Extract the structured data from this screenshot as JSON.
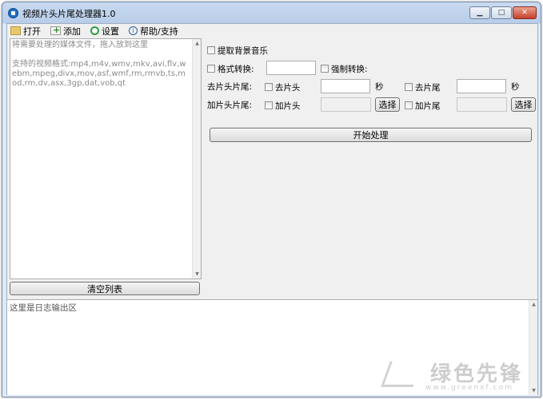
{
  "window": {
    "title": "视频片头片尾处理器1.0",
    "controls": {
      "minimize": "▁",
      "maximize": "□",
      "close": "✕"
    }
  },
  "menu": {
    "items": [
      {
        "label": "打开",
        "icon": "folder-open-icon"
      },
      {
        "label": "添加",
        "icon": "add-file-icon"
      },
      {
        "label": "设置",
        "icon": "gear-icon"
      },
      {
        "label": "帮助/支持",
        "icon": "info-icon"
      }
    ]
  },
  "filelist": {
    "hint": "将需要处理的媒体文件，拖入放到这里\n\n支持的视频格式:mp4,m4v,wmv,mkv,avi,flv,webm,mpeg,divx,mov,asf,wmf,rm,rmvb,ts,mod,rm,dv,asx,3gp,dat,vob,qt"
  },
  "buttons": {
    "clear_list": "清空列表",
    "start": "开始处理",
    "choose_head": "选择",
    "choose_tail": "选择"
  },
  "options": {
    "extract_bgm": "提取背景音乐",
    "format_convert_label": "格式转换:",
    "force_convert": "强制转换:",
    "cut_label": "去片头片尾:",
    "cut_head": "去片头",
    "cut_tail": "去片尾",
    "seconds_unit_1": "秒",
    "seconds_unit_2": "秒",
    "add_label": "加片头片尾:",
    "add_head": "加片头",
    "add_tail": "加片尾"
  },
  "log": {
    "placeholder": "这里是日志输出区"
  },
  "watermark": {
    "text": "绿色先锋",
    "sub": "www.greenxf.com"
  }
}
